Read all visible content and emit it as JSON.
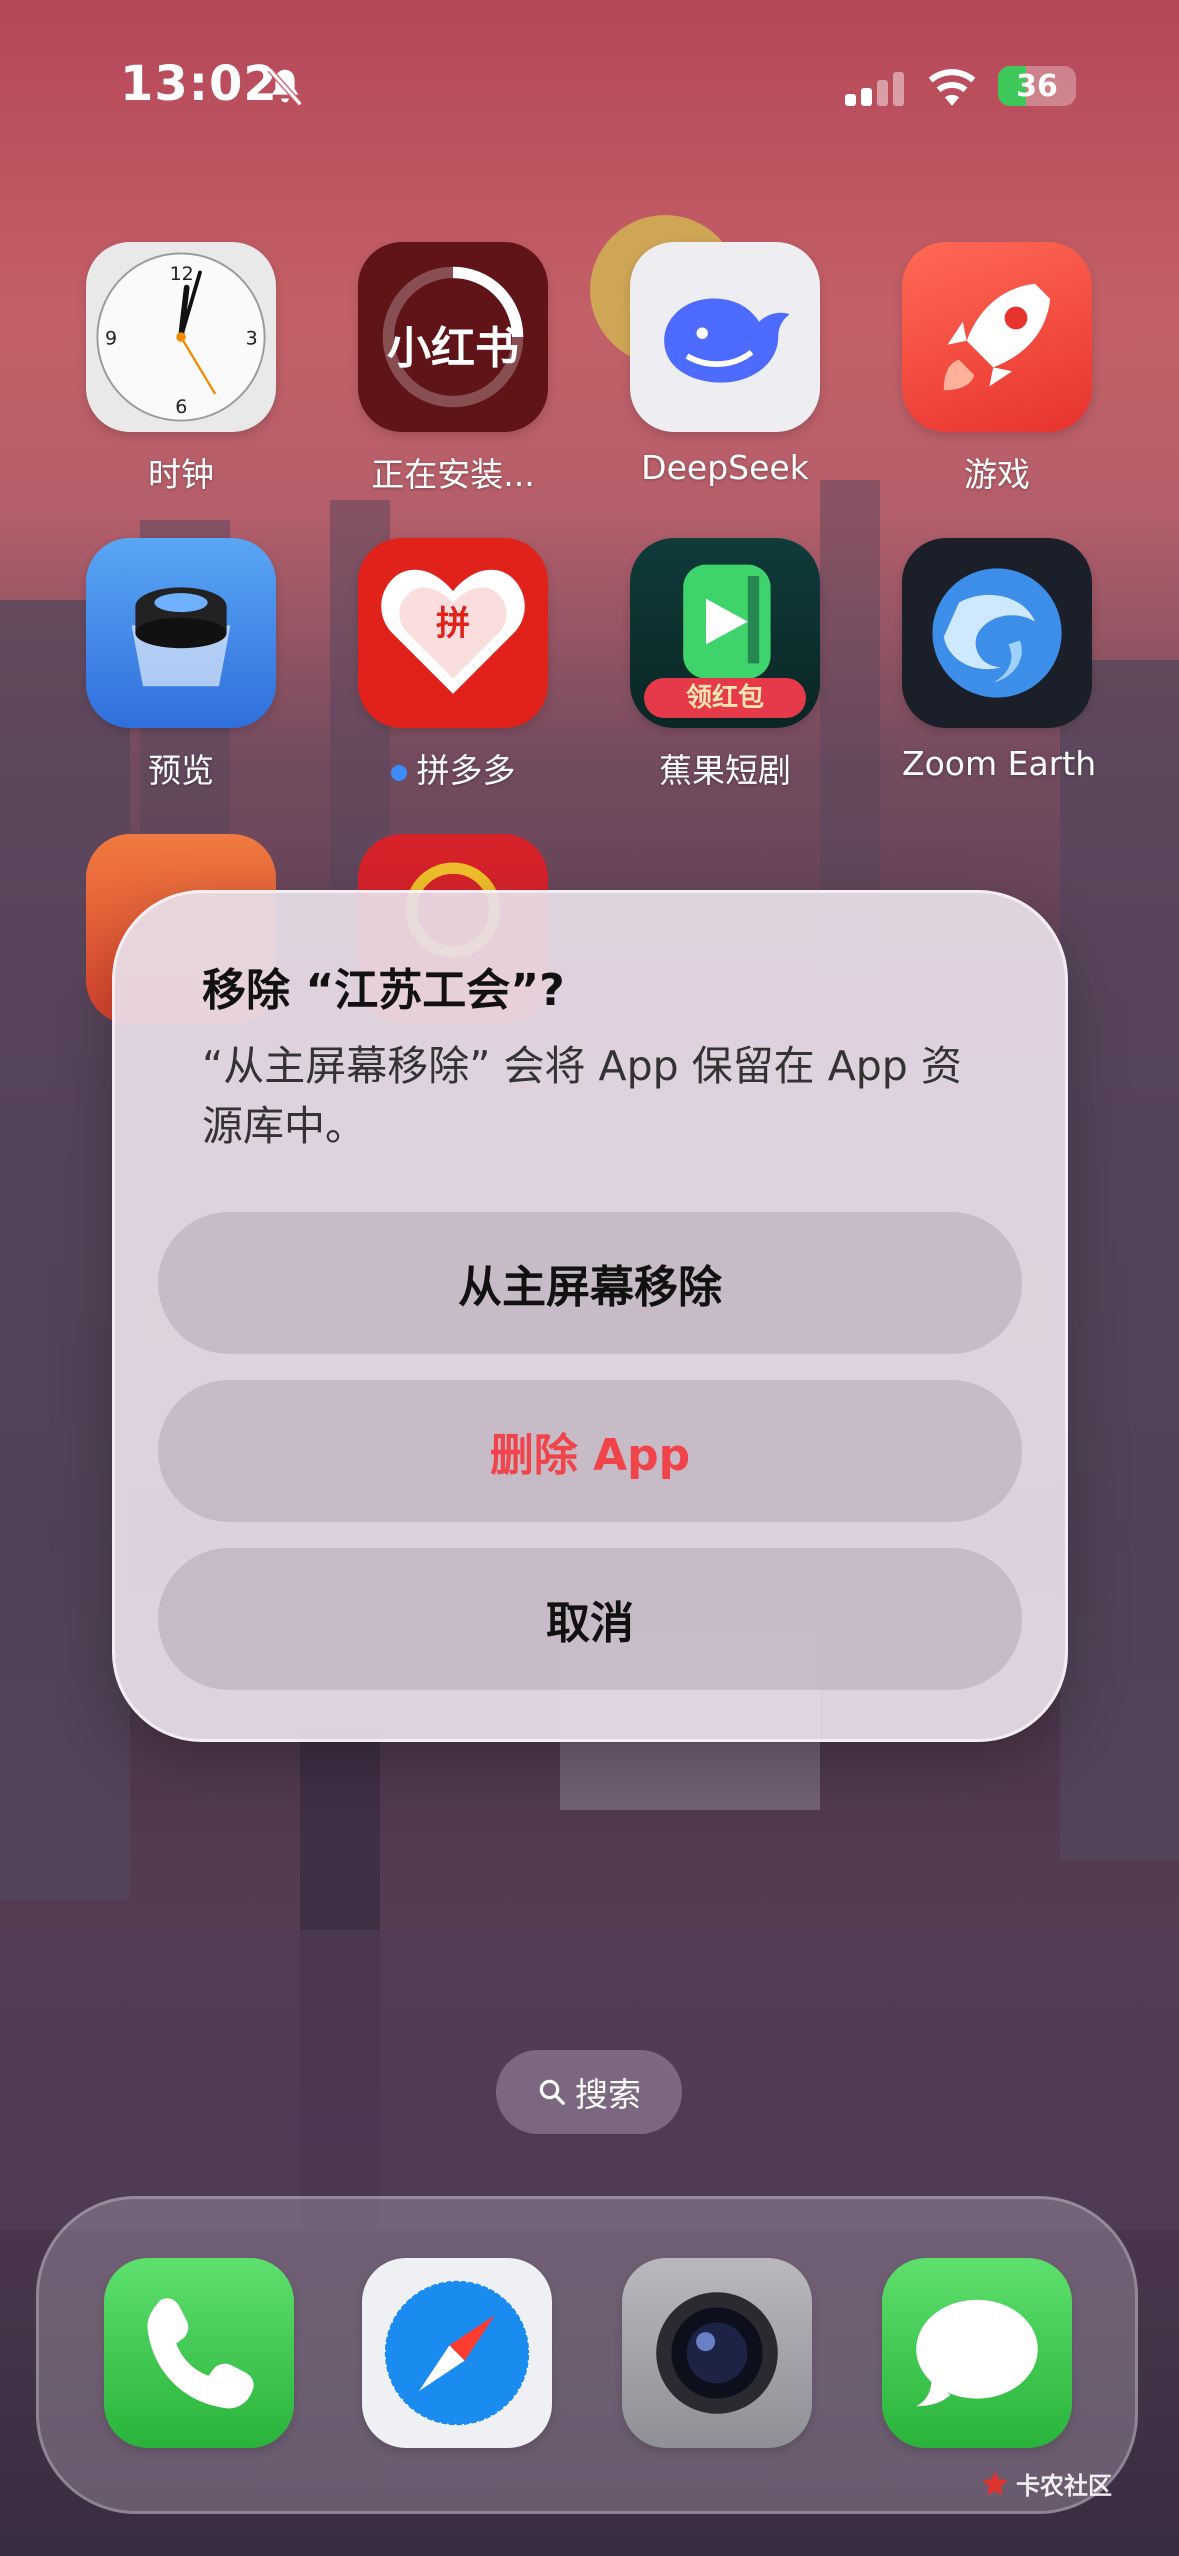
{
  "status_bar": {
    "time": "13:02",
    "battery": "36",
    "battery_level": 0.36
  },
  "home": {
    "apps": [
      {
        "label": "时钟",
        "icon": "clock-icon"
      },
      {
        "label": "正在安装...",
        "icon": "xiaohongshu-icon"
      },
      {
        "label": "DeepSeek",
        "icon": "deepseek-whale-icon"
      },
      {
        "label": "游戏",
        "icon": "rocket-icon"
      },
      {
        "label": "预览",
        "icon": "preview-loupe-icon"
      },
      {
        "label": "拼多多",
        "icon": "pinduoduo-icon",
        "badge_dot": true
      },
      {
        "label": "蕉果短剧",
        "icon": "drama-play-icon",
        "badge_text": "领红包"
      },
      {
        "label": "Zoom Earth",
        "icon": "zoom-earth-icon"
      }
    ],
    "pdd_icon_text": "拼",
    "xhs_icon_text": "小红书"
  },
  "dialog": {
    "title": "移除 “江苏工会”?",
    "message": "“从主屏幕移除” 会将 App 保留在 App 资源库中。",
    "buttons": {
      "remove": "从主屏幕移除",
      "delete": "删除 App",
      "cancel": "取消"
    },
    "destructive_color": "#f0434a"
  },
  "search": {
    "label": "搜索"
  },
  "dock": {
    "apps": [
      {
        "name": "phone",
        "icon": "phone-icon"
      },
      {
        "name": "safari",
        "icon": "safari-compass-icon"
      },
      {
        "name": "camera",
        "icon": "camera-lens-icon"
      },
      {
        "name": "messages",
        "icon": "messages-bubble-icon"
      }
    ]
  },
  "watermark": {
    "text": "卡农社区"
  }
}
